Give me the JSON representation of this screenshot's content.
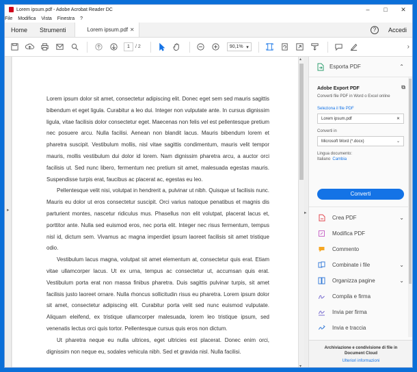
{
  "window": {
    "title": "Lorem ipsum.pdf - Adobe Acrobat Reader DC",
    "controls": [
      "minimize-icon",
      "maximize-icon",
      "close-icon"
    ]
  },
  "menu": [
    "File",
    "Modifica",
    "Vista",
    "Finestra",
    "?"
  ],
  "tabs": {
    "home": "Home",
    "tools": "Strumenti",
    "document": "Lorem ipsum.pdf",
    "signin": "Accedi"
  },
  "toolbar": {
    "page_current": "1",
    "page_total": "/ 2",
    "zoom": "90,1%",
    "icons": [
      "save-icon",
      "upload-icon",
      "print-icon",
      "email-icon",
      "search-icon",
      "previous-page-icon",
      "next-page-icon",
      "select-cursor-icon",
      "hand-icon",
      "zoom-out-icon",
      "zoom-in-icon",
      "fit-page-icon",
      "rotate-icon",
      "full-screen-icon",
      "read-mode-icon",
      "comment-icon",
      "sign-icon"
    ]
  },
  "document": {
    "paragraphs": [
      "Lorem ipsum dolor sit amet, consectetur adipiscing elit. Donec eget sem sed mauris sagittis bibendum et eget ligula. Curabitur a leo dui. Integer non vulputate ante. In cursus dignissim ligula, vitae facilisis dolor consectetur eget. Maecenas non felis vel est pellentesque pretium nec posuere arcu. Nulla facilisi. Aenean non blandit lacus. Mauris bibendum lorem et pharetra suscipit. Vestibulum mollis, nisl vitae sagittis condimentum, mauris velit tempor mauris, mollis vestibulum dui dolor id lorem. Nam dignissim pharetra arcu, a auctor orci facilisis ut. Sed nunc libero, fermentum nec pretium sit amet, malesuada egestas mauris. Suspendisse turpis erat, faucibus ac placerat ac, egestas eu leo.",
      "Pellentesque velit nisi, volutpat in hendrerit a, pulvinar ut nibh. Quisque ut facilisis nunc. Mauris eu dolor ut eros consectetur suscipit. Orci varius natoque penatibus et magnis dis parturient montes, nascetur ridiculus mus. Phasellus non elit volutpat, placerat lacus et, porttitor ante. Nulla sed euismod eros, nec porta elit. Integer nec risus fermentum, tempus nisl id, dictum sem. Vivamus ac magna imperdiet ipsum laoreet facilisis sit amet tristique odio.",
      "Vestibulum lacus magna, volutpat sit amet elementum at, consectetur quis erat. Etiam vitae ullamcorper lacus. Ut ex urna, tempus ac consectetur ut, accumsan quis erat. Vestibulum porta erat non massa finibus pharetra. Duis sagittis pulvinar turpis, sit amet facilisis justo laoreet ornare. Nulla rhoncus sollicitudin risus eu pharetra. Lorem ipsum dolor sit amet, consectetur adipiscing elit. Curabitur porta velit sed nunc euismod vulputate. Aliquam eleifend, ex tristique ullamcorper malesuada, lorem leo tristique ipsum, sed venenatis lectus orci quis tortor. Pellentesque cursus quis eros non dictum.",
      "Ut pharetra neque eu nulla ultrices, eget ultricies est placerat. Donec enim orci, dignissim non neque eu, sodales vehicula nibh. Sed et gravida nisl. Nulla facilisi."
    ]
  },
  "pane": {
    "header": "Esporta PDF",
    "export_title": "Adobe Export PDF",
    "export_desc": "Converti file PDF in Word o Excel online",
    "select_link": "Seleziona il file PDF",
    "file_name": "Lorem ipsum.pdf",
    "convert_label": "Converti in",
    "convert_value": "Microsoft Word (*.docx)",
    "lang_label": "Lingua documento:",
    "lang_value": "Italiano",
    "lang_change": "Cambia",
    "convert_button": "Converti",
    "tools": [
      {
        "label": "Crea PDF",
        "icon": "create-pdf-icon",
        "color": "#e34850"
      },
      {
        "label": "Modifica PDF",
        "icon": "edit-pdf-icon",
        "color": "#c868c8"
      },
      {
        "label": "Commento",
        "icon": "comment-icon",
        "color": "#f5a623"
      },
      {
        "label": "Combinate i file",
        "icon": "combine-files-icon",
        "color": "#3b7fd9"
      },
      {
        "label": "Organizza pagine",
        "icon": "organize-pages-icon",
        "color": "#3b7fd9"
      },
      {
        "label": "Compila e firma",
        "icon": "fill-sign-icon",
        "color": "#7b6fd0"
      },
      {
        "label": "Invia per firma",
        "icon": "send-for-signature-icon",
        "color": "#7b6fd0"
      },
      {
        "label": "Invia e traccia",
        "icon": "send-track-icon",
        "color": "#3b7fd9"
      }
    ],
    "footer_text": "Archiviazione e condivisione di file in Document Cloud",
    "footer_link": "Ulteriori informazioni"
  },
  "colors": {
    "accent": "#1473e6",
    "desktop": "#0b6fd8"
  }
}
